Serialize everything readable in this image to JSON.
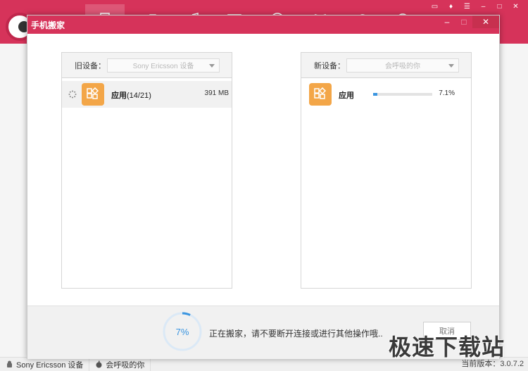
{
  "background_app": {
    "nav_icons": [
      "phone-icon",
      "apps-icon",
      "music-icon",
      "picture-icon",
      "video-icon",
      "book-icon",
      "search-icon",
      "tools-icon"
    ],
    "window_controls": [
      "chat-icon",
      "shirt-icon",
      "menu-icon",
      "minimize-icon",
      "maximize-icon",
      "close-icon"
    ],
    "status_bar": {
      "device_1": "Sony Ericsson 设备",
      "device_2": "会呼吸的你",
      "version": "当前版本：3.0.7.2"
    }
  },
  "dialog": {
    "title": "手机搬家",
    "old_panel": {
      "label": "旧设备：",
      "device": "Sony Ericsson 设备",
      "item": {
        "name": "应用",
        "count": "(14/21)",
        "size": "391 MB"
      }
    },
    "new_panel": {
      "label": "新设备：",
      "device": "会呼吸的你",
      "item": {
        "name": "应用",
        "percent_text": "7.1%",
        "progress": 0.071
      }
    },
    "footer": {
      "overall_percent_text": "7%",
      "overall_progress": 0.07,
      "status_message": "正在搬家，请不要断开连接或进行其他操作哦..",
      "cancel_label": "取消"
    }
  },
  "watermark": "极速下载站",
  "colors": {
    "accent": "#d6335a",
    "progress": "#3a95e0",
    "app_icon": "#f3a648"
  }
}
